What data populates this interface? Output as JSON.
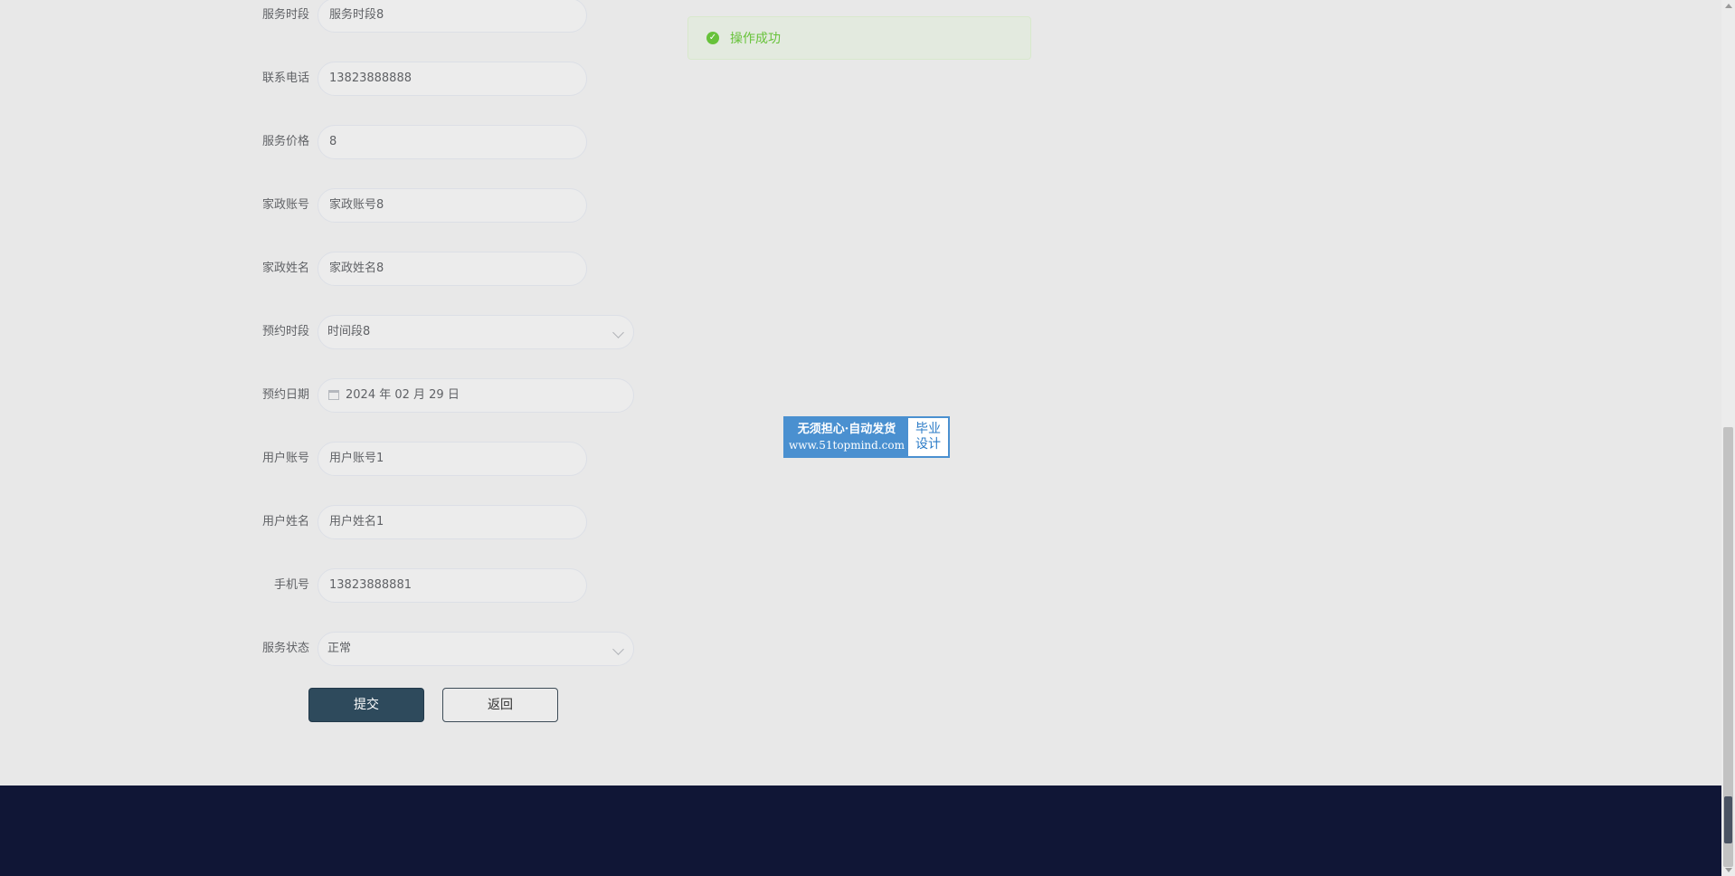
{
  "form": {
    "fields": [
      {
        "label": "服务时段",
        "value": "服务时段8"
      },
      {
        "label": "联系电话",
        "value": "13823888888"
      },
      {
        "label": "服务价格",
        "value": "8"
      },
      {
        "label": "家政账号",
        "value": "家政账号8"
      },
      {
        "label": "家政姓名",
        "value": "家政姓名8"
      },
      {
        "label": "预约时段",
        "value": "时间段8"
      },
      {
        "label": "预约日期",
        "value": "2024 年 02 月 29 日"
      },
      {
        "label": "用户账号",
        "value": "用户账号1"
      },
      {
        "label": "用户姓名",
        "value": "用户姓名1"
      },
      {
        "label": "手机号",
        "value": "13823888881"
      },
      {
        "label": "服务状态",
        "value": "正常"
      }
    ],
    "submit_label": "提交",
    "back_label": "返回"
  },
  "toast": {
    "message": "操作成功",
    "icon": "check-circle-icon",
    "color": "#67c23a"
  },
  "badge": {
    "line1": "无须担心·自动发货",
    "line2": "www.51topmind.com",
    "side1": "毕业",
    "side2": "设计"
  },
  "colors": {
    "footer": "#101636",
    "submit_button": "#2e4a5c",
    "background": "#e8e8e8"
  }
}
